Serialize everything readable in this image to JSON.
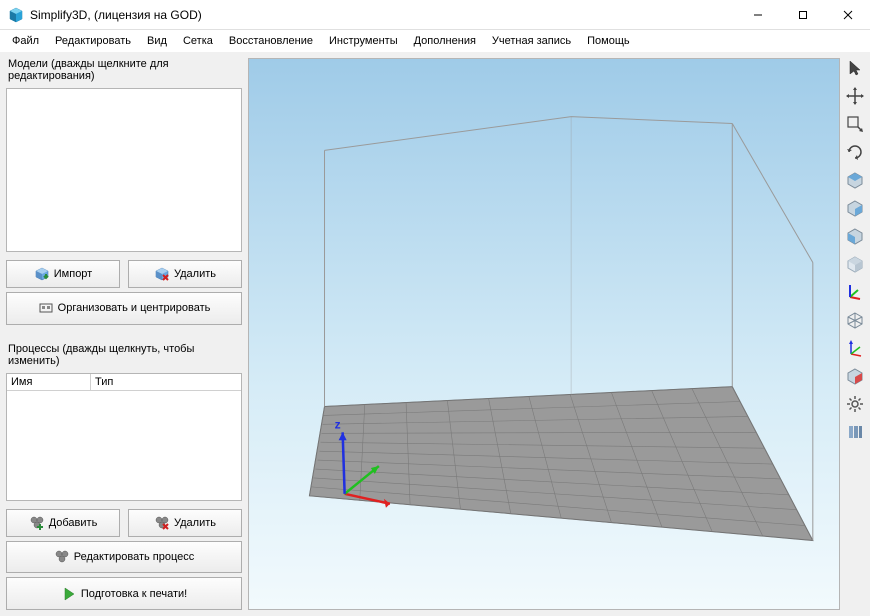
{
  "window": {
    "title": "Simplify3D, (лицензия на GOD)"
  },
  "menu": {
    "file": "Файл",
    "edit": "Редактировать",
    "view": "Вид",
    "mesh": "Сетка",
    "restore": "Восстановление",
    "tools": "Инструменты",
    "addons": "Дополнения",
    "account": "Учетная запись",
    "help": "Помощь"
  },
  "panels": {
    "models_label": "Модели (дважды щелкните для редактирования)",
    "processes_label": "Процессы (дважды щелкнуть, чтобы изменить)",
    "proc_col_name": "Имя",
    "proc_col_type": "Тип"
  },
  "buttons": {
    "import": "Импорт",
    "delete": "Удалить",
    "organize": "Организовать и центрировать",
    "add": "Добавить",
    "delete2": "Удалить",
    "edit_process": "Редактировать процесс",
    "prepare": "Подготовка к печати!"
  },
  "axis": {
    "z": "z"
  }
}
